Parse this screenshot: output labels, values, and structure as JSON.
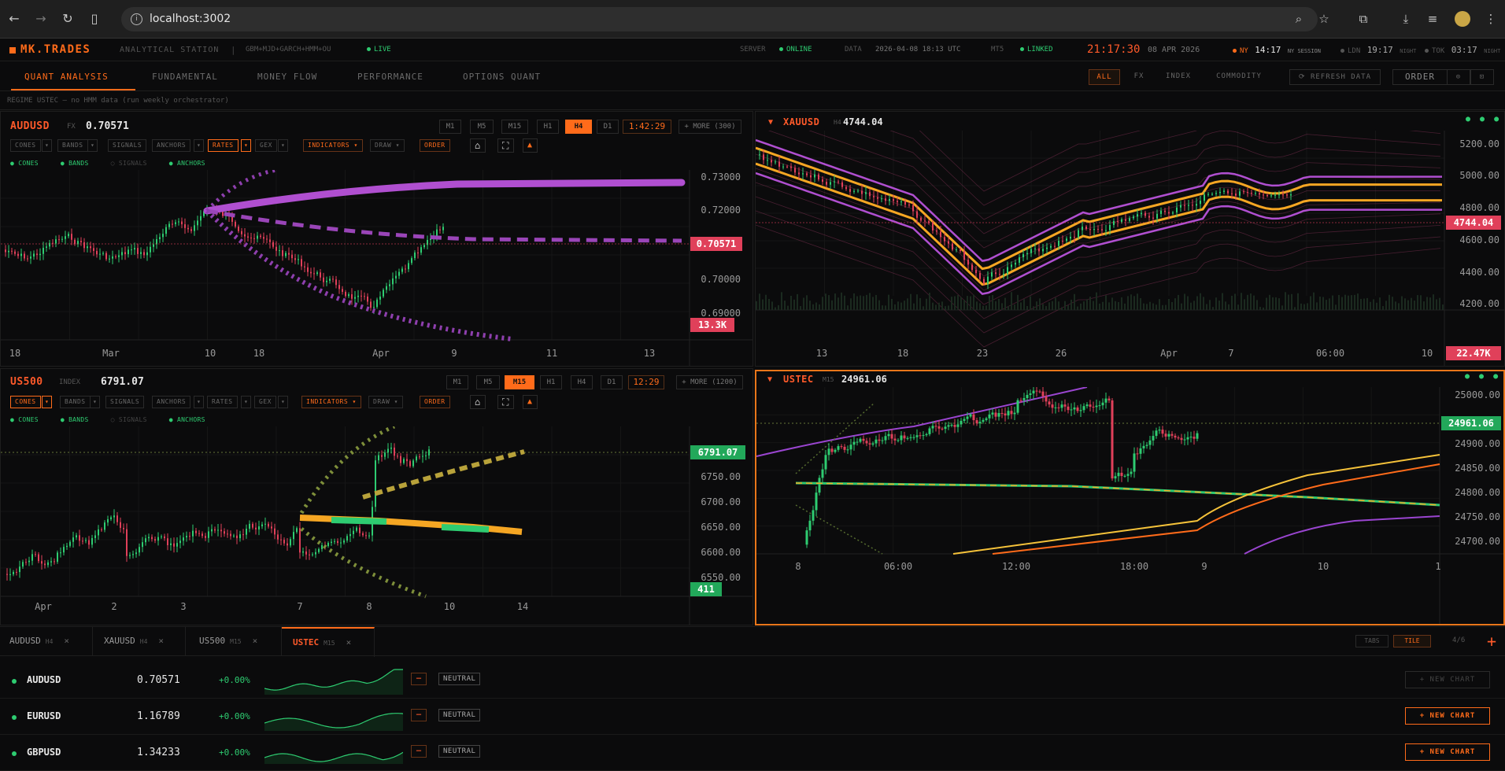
{
  "browser": {
    "url": "localhost:3002"
  },
  "app": {
    "logo": "MK.TRADES",
    "subtitle": "ANALYTICAL STATION",
    "engine": "GBM+MJD+GARCH+HMM+OU",
    "live": "LIVE",
    "server_label": "SERVER",
    "server_status": "ONLINE",
    "data_label": "DATA",
    "data_time": "2026-04-08 18:13 UTC",
    "mt5_label": "MT5",
    "mt5_status": "LINKED",
    "clock": "21:17:30",
    "date": "08 APR 2026",
    "sessions": [
      {
        "name": "NY",
        "time": "14:17",
        "note": "NY SESSION",
        "active": true
      },
      {
        "name": "LDN",
        "time": "19:17",
        "note": "NIGHT",
        "active": false
      },
      {
        "name": "TOK",
        "time": "03:17",
        "note": "NIGHT",
        "active": false
      }
    ]
  },
  "nav": {
    "tabs": [
      "QUANT ANALYSIS",
      "FUNDAMENTAL",
      "MONEY FLOW",
      "PERFORMANCE",
      "OPTIONS QUANT"
    ],
    "filters": [
      "ALL",
      "FX",
      "INDEX",
      "COMMODITY"
    ],
    "refresh": "⟳ REFRESH DATA",
    "order": "ORDER"
  },
  "regime": "REGIME  USTEC — no HMM data (run weekly orchestrator)",
  "panels": {
    "audusd": {
      "symbol": "AUDUSD",
      "type": "FX",
      "price": "0.70571",
      "timeframes": [
        "M1",
        "M5",
        "M15",
        "H1",
        "H4",
        "D1"
      ],
      "active_tf": "H4",
      "countdown": "1:42:29",
      "more": "+ MORE (300)",
      "tools": [
        "CONES",
        "BANDS",
        "SIGNALS",
        "ANCHORS",
        "RATES",
        "GEX"
      ],
      "indicators": "INDICATORS ▾",
      "draw": "DRAW ▾",
      "order": "ORDER",
      "legend": [
        "CONES",
        "BANDS",
        "SIGNALS",
        "ANCHORS"
      ],
      "yticks": [
        "0.73000",
        "0.72000",
        "0.71000",
        "0.70000",
        "0.69000"
      ],
      "xticks": [
        "18",
        "Mar",
        "10",
        "18",
        "Apr",
        "9",
        "11",
        "13"
      ],
      "price_badge": "0.70571",
      "vol_badge": "13.3K"
    },
    "xauusd": {
      "symbol": "XAUUSD",
      "type": "H4",
      "price": "4744.04",
      "yticks": [
        "5200.00",
        "5000.00",
        "4800.00",
        "4600.00",
        "4400.00",
        "4200.00"
      ],
      "xticks": [
        "13",
        "18",
        "23",
        "26",
        "Apr",
        "7",
        "06:00",
        "10"
      ],
      "price_badge": "4744.04",
      "vol_badge": "22.47K"
    },
    "us500": {
      "symbol": "US500",
      "type": "INDEX",
      "price": "6791.07",
      "timeframes": [
        "M1",
        "M5",
        "M15",
        "H1",
        "H4",
        "D1"
      ],
      "active_tf": "M15",
      "countdown": "12:29",
      "more": "+ MORE (1200)",
      "tools": [
        "CONES",
        "BANDS",
        "SIGNALS",
        "ANCHORS",
        "RATES",
        "GEX"
      ],
      "indicators": "INDICATORS ▾",
      "draw": "DRAW ▾",
      "order": "ORDER",
      "legend": [
        "CONES",
        "BANDS",
        "SIGNALS",
        "ANCHORS"
      ],
      "yticks": [
        "6750.00",
        "6700.00",
        "6650.00",
        "6600.00",
        "6550.00"
      ],
      "xticks": [
        "Apr",
        "2",
        "3",
        "7",
        "8",
        "10",
        "14"
      ],
      "price_badge": "6791.07",
      "vol_badge": "411"
    },
    "ustec": {
      "symbol": "USTEC",
      "type": "M15",
      "price": "24961.06",
      "yticks": [
        "25000.00",
        "24900.00",
        "24850.00",
        "24800.00",
        "24750.00",
        "24700.00"
      ],
      "xticks": [
        "8",
        "06:00",
        "12:00",
        "18:00",
        "9",
        "10",
        "1"
      ],
      "price_badge": "24961.06"
    }
  },
  "chart_tabs": [
    {
      "symbol": "AUDUSD",
      "tf": "H4"
    },
    {
      "symbol": "XAUUSD",
      "tf": "H4"
    },
    {
      "symbol": "US500",
      "tf": "M15"
    },
    {
      "symbol": "USTEC",
      "tf": "M15"
    }
  ],
  "layout_controls": {
    "tabs": "TABS",
    "tile": "TILE",
    "count": "4/6",
    "add": "+"
  },
  "watchlist": [
    {
      "symbol": "AUDUSD",
      "price": "0.70571",
      "change": "+0.00%",
      "bias": "NEUTRAL",
      "action": "+ NEW CHART",
      "open": true
    },
    {
      "symbol": "EURUSD",
      "price": "1.16789",
      "change": "+0.00%",
      "bias": "NEUTRAL",
      "action": "+ NEW CHART",
      "open": false
    },
    {
      "symbol": "GBPUSD",
      "price": "1.34233",
      "change": "+0.00%",
      "bias": "NEUTRAL",
      "action": "+ NEW CHART",
      "open": false
    }
  ],
  "colors": {
    "accent": "#ff6b1a",
    "up": "#2ecc71",
    "down": "#e0405a",
    "purple": "#b04fd0",
    "gold": "#f5a623"
  }
}
